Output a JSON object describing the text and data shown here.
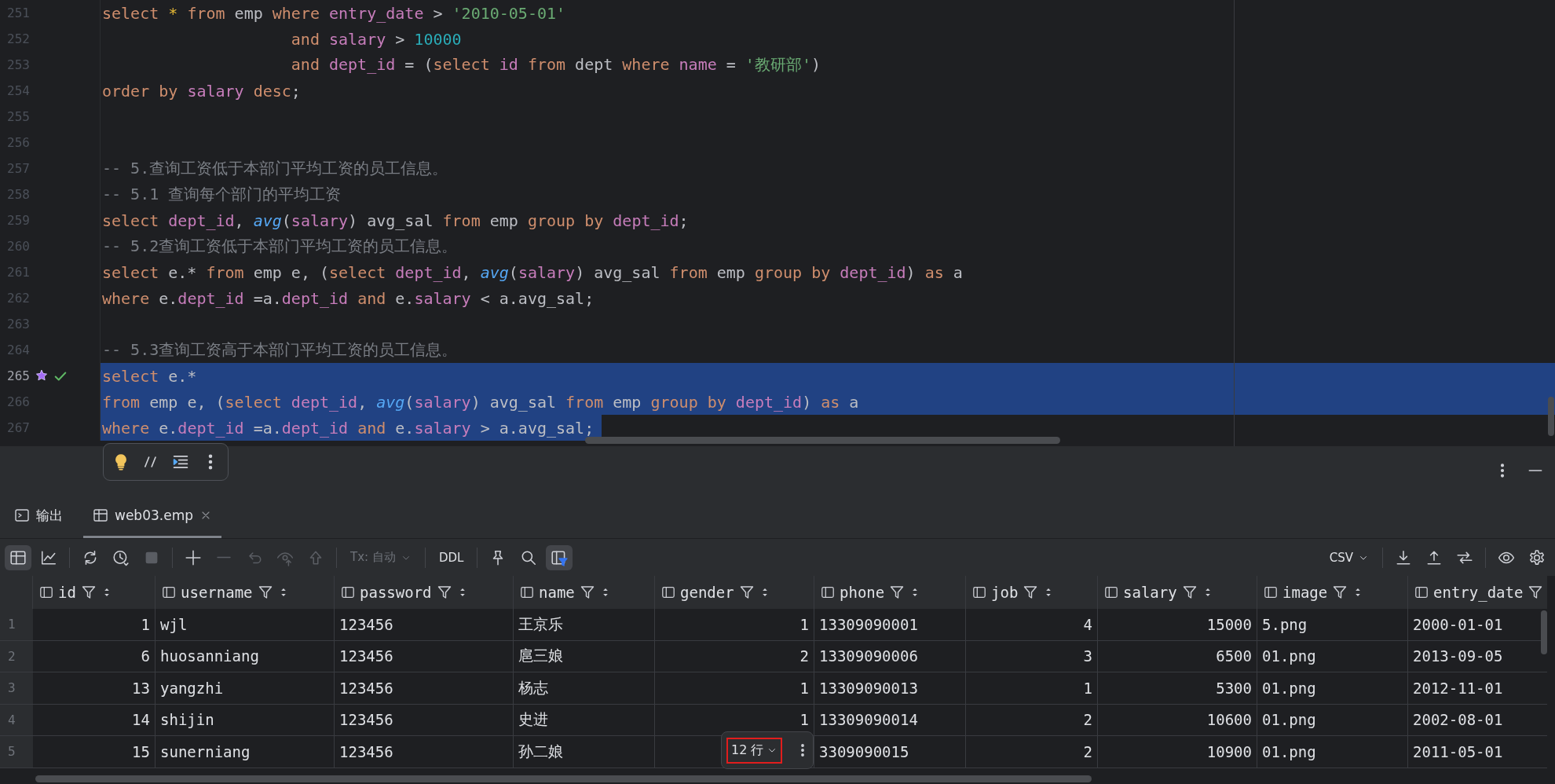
{
  "editor": {
    "lines": [
      {
        "number": "251",
        "selected": false,
        "executed": false,
        "tokens": [
          {
            "kind": "keyword",
            "text": "select "
          },
          {
            "kind": "wildcard",
            "text": "* "
          },
          {
            "kind": "keyword",
            "text": "from"
          },
          {
            "kind": "plain",
            "text": " emp "
          },
          {
            "kind": "keyword",
            "text": "where "
          },
          {
            "kind": "field",
            "text": "entry_date"
          },
          {
            "kind": "plain",
            "text": " > "
          },
          {
            "kind": "string",
            "text": "'2010-05-01'"
          }
        ]
      },
      {
        "number": "252",
        "selected": false,
        "executed": false,
        "tokens": [
          {
            "kind": "keyword",
            "text": "                    and "
          },
          {
            "kind": "field",
            "text": "salary"
          },
          {
            "kind": "plain",
            "text": " > "
          },
          {
            "kind": "number",
            "text": "10000"
          }
        ]
      },
      {
        "number": "253",
        "selected": false,
        "executed": false,
        "tokens": [
          {
            "kind": "keyword",
            "text": "                    and "
          },
          {
            "kind": "field",
            "text": "dept_id"
          },
          {
            "kind": "plain",
            "text": " = ("
          },
          {
            "kind": "keyword",
            "text": "select "
          },
          {
            "kind": "field",
            "text": "id "
          },
          {
            "kind": "keyword",
            "text": "from"
          },
          {
            "kind": "plain",
            "text": " dept "
          },
          {
            "kind": "keyword",
            "text": "where "
          },
          {
            "kind": "field",
            "text": "name"
          },
          {
            "kind": "plain",
            "text": " = "
          },
          {
            "kind": "string",
            "text": "'教研部'"
          },
          {
            "kind": "plain",
            "text": ")"
          }
        ]
      },
      {
        "number": "254",
        "selected": false,
        "executed": false,
        "tokens": [
          {
            "kind": "keyword",
            "text": "order by "
          },
          {
            "kind": "field",
            "text": "salary "
          },
          {
            "kind": "keyword",
            "text": "desc"
          },
          {
            "kind": "plain",
            "text": ";"
          }
        ]
      },
      {
        "number": "255",
        "selected": false,
        "executed": false
      },
      {
        "number": "256",
        "selected": false,
        "executed": false
      },
      {
        "number": "257",
        "selected": false,
        "executed": false,
        "tokens": [
          {
            "kind": "comment",
            "text": "-- 5.查询工资低于本部门平均工资的员工信息。"
          }
        ]
      },
      {
        "number": "258",
        "selected": false,
        "executed": false,
        "tokens": [
          {
            "kind": "comment",
            "text": "-- 5.1 查询每个部门的平均工资"
          }
        ]
      },
      {
        "number": "259",
        "selected": false,
        "executed": false,
        "tokens": [
          {
            "kind": "keyword",
            "text": "select "
          },
          {
            "kind": "field",
            "text": "dept_id"
          },
          {
            "kind": "plain",
            "text": ", "
          },
          {
            "kind": "function",
            "text": "avg"
          },
          {
            "kind": "plain",
            "text": "("
          },
          {
            "kind": "field",
            "text": "salary"
          },
          {
            "kind": "plain",
            "text": ") avg_sal "
          },
          {
            "kind": "keyword",
            "text": "from"
          },
          {
            "kind": "plain",
            "text": " emp "
          },
          {
            "kind": "keyword",
            "text": "group by "
          },
          {
            "kind": "field",
            "text": "dept_id"
          },
          {
            "kind": "plain",
            "text": ";"
          }
        ]
      },
      {
        "number": "260",
        "selected": false,
        "executed": false,
        "tokens": [
          {
            "kind": "comment",
            "text": "-- 5.2查询工资低于本部门平均工资的员工信息。"
          }
        ]
      },
      {
        "number": "261",
        "selected": false,
        "executed": false,
        "tokens": [
          {
            "kind": "keyword",
            "text": "select"
          },
          {
            "kind": "plain",
            "text": " e.* "
          },
          {
            "kind": "keyword",
            "text": "from"
          },
          {
            "kind": "plain",
            "text": " emp e, ("
          },
          {
            "kind": "keyword",
            "text": "select "
          },
          {
            "kind": "field",
            "text": "dept_id"
          },
          {
            "kind": "plain",
            "text": ", "
          },
          {
            "kind": "function",
            "text": "avg"
          },
          {
            "kind": "plain",
            "text": "("
          },
          {
            "kind": "field",
            "text": "salary"
          },
          {
            "kind": "plain",
            "text": ") avg_sal "
          },
          {
            "kind": "keyword",
            "text": "from"
          },
          {
            "kind": "plain",
            "text": " emp "
          },
          {
            "kind": "keyword",
            "text": "group by "
          },
          {
            "kind": "field",
            "text": "dept_id"
          },
          {
            "kind": "plain",
            "text": ") "
          },
          {
            "kind": "keyword",
            "text": "as"
          },
          {
            "kind": "plain",
            "text": " a"
          }
        ]
      },
      {
        "number": "262",
        "selected": false,
        "executed": false,
        "tokens": [
          {
            "kind": "keyword",
            "text": "where"
          },
          {
            "kind": "plain",
            "text": " e."
          },
          {
            "kind": "field",
            "text": "dept_id"
          },
          {
            "kind": "plain",
            "text": " =a."
          },
          {
            "kind": "field",
            "text": "dept_id "
          },
          {
            "kind": "keyword",
            "text": "and"
          },
          {
            "kind": "plain",
            "text": " e."
          },
          {
            "kind": "field",
            "text": "salary"
          },
          {
            "kind": "plain",
            "text": " < a.avg_sal;"
          }
        ]
      },
      {
        "number": "263",
        "selected": false,
        "executed": false
      },
      {
        "number": "264",
        "selected": false,
        "executed": false,
        "tokens": [
          {
            "kind": "comment",
            "text": "-- 5.3查询工资高于本部门平均工资的员工信息。"
          }
        ]
      },
      {
        "number": "265",
        "selected": true,
        "executed": true,
        "tokens": [
          {
            "kind": "keyword",
            "text": "select"
          },
          {
            "kind": "plain",
            "text": " e.*"
          }
        ]
      },
      {
        "number": "266",
        "selected": true,
        "executed": false,
        "tokens": [
          {
            "kind": "keyword",
            "text": "from"
          },
          {
            "kind": "plain",
            "text": " emp e, ("
          },
          {
            "kind": "keyword",
            "text": "select "
          },
          {
            "kind": "field",
            "text": "dept_id"
          },
          {
            "kind": "plain",
            "text": ", "
          },
          {
            "kind": "function",
            "text": "avg"
          },
          {
            "kind": "plain",
            "text": "("
          },
          {
            "kind": "field",
            "text": "salary"
          },
          {
            "kind": "plain",
            "text": ") avg_sal "
          },
          {
            "kind": "keyword",
            "text": "from"
          },
          {
            "kind": "plain",
            "text": " emp "
          },
          {
            "kind": "keyword",
            "text": "group by "
          },
          {
            "kind": "field",
            "text": "dept_id"
          },
          {
            "kind": "plain",
            "text": ") "
          },
          {
            "kind": "keyword",
            "text": "as"
          },
          {
            "kind": "plain",
            "text": " a"
          }
        ]
      },
      {
        "number": "267",
        "selected": true,
        "executed": false,
        "tokens": [
          {
            "kind": "keyword",
            "text": "where"
          },
          {
            "kind": "plain",
            "text": " e."
          },
          {
            "kind": "field",
            "text": "dept_id"
          },
          {
            "kind": "plain",
            "text": " =a."
          },
          {
            "kind": "field",
            "text": "dept_id "
          },
          {
            "kind": "keyword",
            "text": "and"
          },
          {
            "kind": "plain",
            "text": " e."
          },
          {
            "kind": "field",
            "text": "salary"
          },
          {
            "kind": "plain",
            "text": " > a.avg_sal;"
          }
        ]
      }
    ]
  },
  "panel_tabs": [
    {
      "label": "输出",
      "selected": false,
      "closable": false
    },
    {
      "label": "web03.emp",
      "selected": true,
      "closable": true
    }
  ],
  "toolbar": {
    "left": [
      {
        "kind": "icon",
        "selected": true,
        "disabled": false
      },
      {
        "kind": "icon",
        "selected": false,
        "disabled": false
      },
      {
        "kind": "separator"
      },
      {
        "kind": "icon",
        "selected": false,
        "disabled": false
      },
      {
        "kind": "icon",
        "selected": false,
        "disabled": false
      },
      {
        "kind": "icon",
        "selected": false,
        "disabled": true
      },
      {
        "kind": "separator"
      },
      {
        "kind": "icon",
        "selected": false,
        "disabled": false
      },
      {
        "kind": "icon",
        "selected": false,
        "disabled": true
      },
      {
        "kind": "icon",
        "selected": false,
        "disabled": true
      },
      {
        "kind": "icon",
        "selected": false,
        "disabled": true
      },
      {
        "kind": "icon",
        "selected": false,
        "disabled": true
      },
      {
        "kind": "separator"
      },
      {
        "kind": "dropdown",
        "label": "Tx: 自动",
        "disabled": true
      },
      {
        "kind": "separator"
      },
      {
        "kind": "text",
        "label": "DDL",
        "disabled": false
      },
      {
        "kind": "separator"
      },
      {
        "kind": "icon",
        "selected": false,
        "disabled": false
      },
      {
        "kind": "icon",
        "selected": false,
        "disabled": false
      },
      {
        "kind": "icon",
        "selected": true,
        "disabled": false
      }
    ],
    "right": [
      {
        "kind": "dropdown",
        "label": "CSV",
        "disabled": false
      },
      {
        "kind": "separator"
      },
      {
        "kind": "icon",
        "selected": false,
        "disabled": false
      },
      {
        "kind": "icon",
        "selected": false,
        "disabled": false
      },
      {
        "kind": "icon",
        "selected": false,
        "disabled": false
      },
      {
        "kind": "separator"
      },
      {
        "kind": "icon",
        "selected": false,
        "disabled": false
      },
      {
        "kind": "icon",
        "selected": false,
        "disabled": false
      }
    ]
  },
  "table": {
    "columns": [
      {
        "name": "id",
        "kind": "number"
      },
      {
        "name": "username",
        "kind": "text"
      },
      {
        "name": "password",
        "kind": "text"
      },
      {
        "name": "name",
        "kind": "text"
      },
      {
        "name": "gender",
        "kind": "number"
      },
      {
        "name": "phone",
        "kind": "text"
      },
      {
        "name": "job",
        "kind": "number"
      },
      {
        "name": "salary",
        "kind": "number"
      },
      {
        "name": "image",
        "kind": "text"
      },
      {
        "name": "entry_date",
        "kind": "text"
      }
    ],
    "rows": [
      {
        "number": "1",
        "cells": [
          "1",
          "wjl",
          "123456",
          "王京乐",
          "1",
          "13309090001",
          "4",
          "15000",
          "5.png",
          "2000-01-01"
        ]
      },
      {
        "number": "2",
        "cells": [
          "6",
          "huosanniang",
          "123456",
          "扈三娘",
          "2",
          "13309090006",
          "3",
          "6500",
          "01.png",
          "2013-09-05"
        ]
      },
      {
        "number": "3",
        "cells": [
          "13",
          "yangzhi",
          "123456",
          "杨志",
          "1",
          "13309090013",
          "1",
          "5300",
          "01.png",
          "2012-11-01"
        ]
      },
      {
        "number": "4",
        "cells": [
          "14",
          "shijin",
          "123456",
          "史进",
          "1",
          "13309090014",
          "2",
          "10600",
          "01.png",
          "2002-08-01"
        ]
      },
      {
        "number": "5",
        "cells": [
          "15",
          "sunerniang",
          "123456",
          "孙二娘",
          null,
          "3309090015",
          "2",
          "10900",
          "01.png",
          "2011-05-01"
        ]
      }
    ]
  },
  "result_bar": {
    "row_count": "12 行"
  }
}
